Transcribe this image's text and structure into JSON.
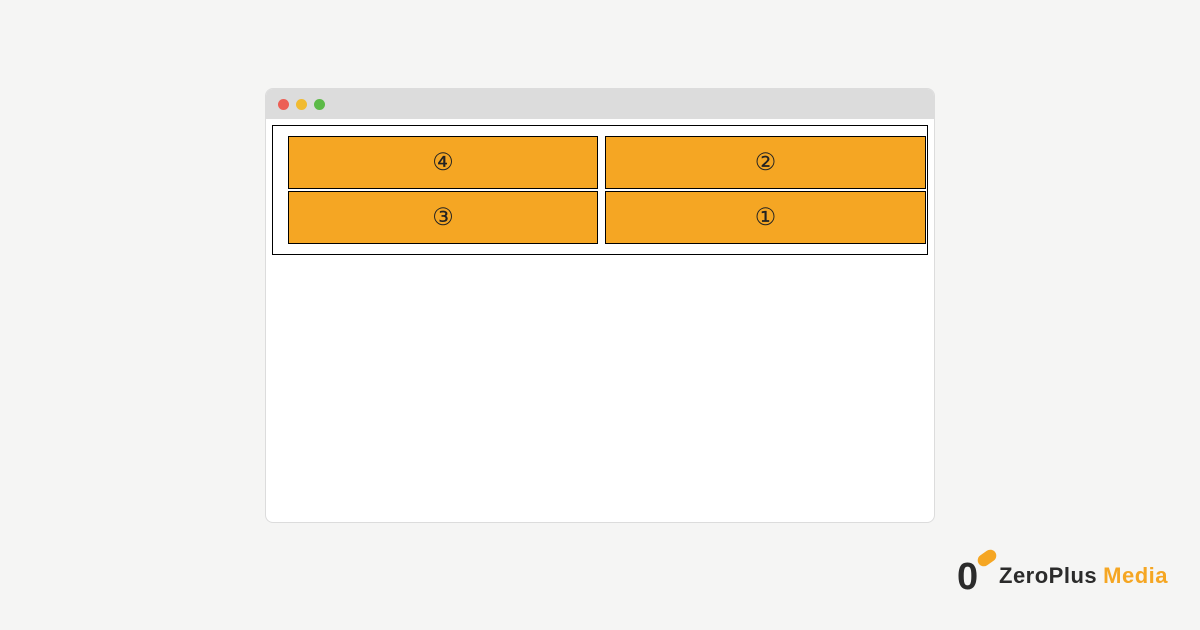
{
  "boxes": {
    "top_left": "④",
    "top_right": "②",
    "bot_left": "③",
    "bot_right": "①"
  },
  "logo": {
    "word1": "ZeroPlus",
    "word2": "Media"
  },
  "colors": {
    "box_bg": "#f5a623",
    "page_bg": "#f5f5f4"
  }
}
